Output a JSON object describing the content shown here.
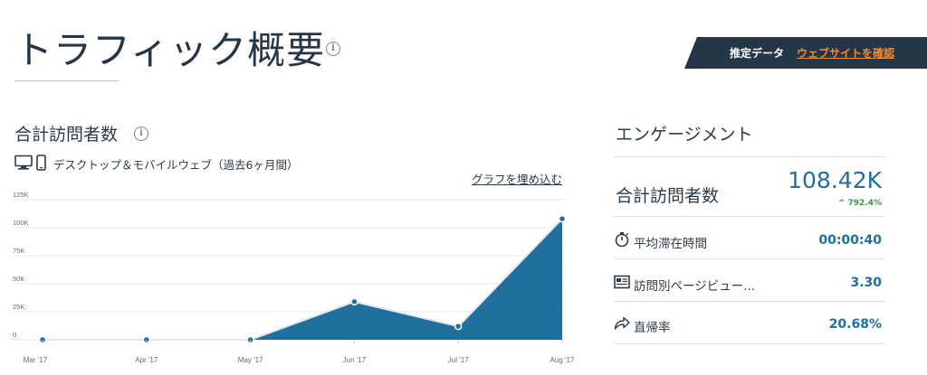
{
  "header": {
    "title": "トラフィック概要",
    "info_glyph": "i",
    "estimate_label": "推定データ",
    "verify_link": "ウェブサイトを確認",
    "banner_color": "#253746",
    "link_color": "#f28a2e"
  },
  "visits_panel": {
    "heading": "合計訪問者数",
    "info_glyph": "i",
    "device_icons": [
      "desktop-icon",
      "mobile-icon"
    ],
    "device_label": "デスクトップ＆モバイルウェブ（過去6ヶ月間）",
    "embed_link": "グラフを埋め込む"
  },
  "chart_data": {
    "type": "area",
    "categories": [
      "Mar '17",
      "Apr '17",
      "May '17",
      "Jun '17",
      "Jul '17",
      "Aug '17"
    ],
    "values": [
      0,
      0,
      0,
      34000,
      12000,
      108000
    ],
    "y_ticks": [
      "0",
      "25K",
      "50K",
      "75K",
      "100K",
      "125K"
    ],
    "ylim": [
      0,
      125000
    ],
    "grid": true,
    "fill_color": "#1f6f9f",
    "line_color": "#e3e6e9",
    "marker_color": "#1f6f9f"
  },
  "engagement": {
    "heading": "エンゲージメント",
    "visits_label": "合計訪問者数",
    "visits_value": "108.42K",
    "visits_change": "792.4%",
    "change_arrow": "^",
    "change_color": "#3b9b3b",
    "value_color": "#1d6fa5",
    "metrics": [
      {
        "icon": "stopwatch-icon",
        "label": "平均滞在時間",
        "value": "00:00:40"
      },
      {
        "icon": "pages-icon",
        "label": "訪問別ページビュー...",
        "value": "3.30"
      },
      {
        "icon": "bounce-arrow-icon",
        "label": "直帰率",
        "value": "20.68%"
      }
    ]
  }
}
